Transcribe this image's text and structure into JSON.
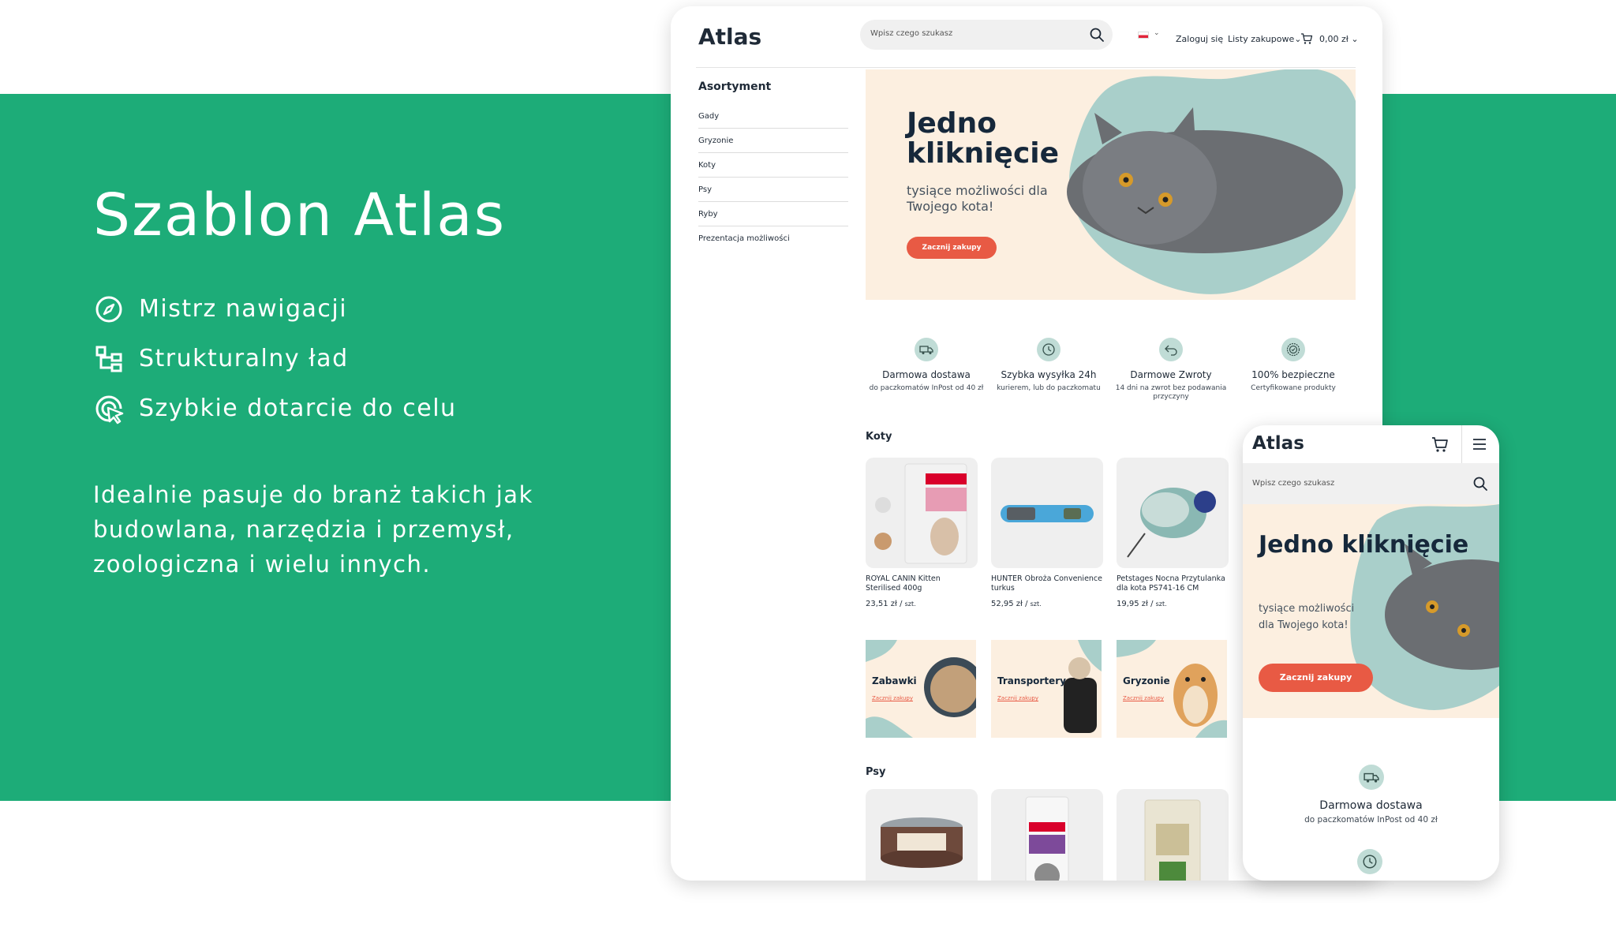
{
  "promo": {
    "title": "Szablon Atlas",
    "features": [
      {
        "label": "Mistrz nawigacji",
        "icon": "compass-icon"
      },
      {
        "label": "Strukturalny ład",
        "icon": "structure-icon"
      },
      {
        "label": "Szybkie dotarcie do celu",
        "icon": "target-cursor-icon"
      }
    ],
    "description": "Idealnie pasuje do branż takich jak budowlana, narzędzia i przemysł, zoologiczna i wielu innych."
  },
  "desktop": {
    "logo": "Atlas",
    "search_placeholder": "Wpisz czego szukasz",
    "login": "Zaloguj się",
    "shopping_lists": "Listy zakupowe",
    "cart_total": "0,00 zł",
    "sidebar": {
      "title": "Asortyment",
      "items": [
        "Gady",
        "Gryzonie",
        "Koty",
        "Psy",
        "Ryby",
        "Prezentacja możliwości"
      ]
    },
    "hero": {
      "title": "Jedno kliknięcie",
      "subtitle": "tysiące możliwości dla Twojego kota!",
      "button": "Zacznij zakupy"
    },
    "benefits": [
      {
        "title": "Darmowa dostawa",
        "desc": "do paczkomatów InPost od 40 zł",
        "icon": "delivery-truck-icon"
      },
      {
        "title": "Szybka wysyłka 24h",
        "desc": "kurierem, lub do paczkomatu",
        "icon": "clock-icon"
      },
      {
        "title": "Darmowe Zwroty",
        "desc": "14 dni na zwrot bez podawania przyczyny",
        "icon": "return-arrow-icon"
      },
      {
        "title": "100% bezpieczne",
        "desc": "Certyfikowane produkty",
        "icon": "certified-badge-icon"
      }
    ],
    "section_cats": "Koty",
    "products": [
      {
        "name": "ROYAL CANIN Kitten Sterilised 400g",
        "price": "23,51 zł",
        "unit": "szt."
      },
      {
        "name": "HUNTER Obroża Convenience turkus",
        "price": "52,95 zł",
        "unit": "szt."
      },
      {
        "name": "Petstages Nocna Przytulanka dla kota PS741-16 CM",
        "price": "19,95 zł",
        "unit": "szt."
      }
    ],
    "categories": [
      {
        "name": "Zabawki",
        "link": "Zacznij zakupy"
      },
      {
        "name": "Transportery",
        "link": "Zacznij zakupy"
      },
      {
        "name": "Gryzonie",
        "link": "Zacznij zakupy"
      }
    ],
    "section_dogs": "Psy"
  },
  "mobile": {
    "logo": "Atlas",
    "search_placeholder": "Wpisz czego szukasz",
    "hero": {
      "title": "Jedno kliknięcie",
      "subtitle": "tysiące możliwości dla Twojego kota!",
      "button": "Zacznij zakupy"
    },
    "benefit": {
      "title": "Darmowa dostawa",
      "desc": "do paczkomatów InPost od 40 zł"
    }
  },
  "colors": {
    "brand_green": "#1dac78",
    "accent_orange": "#e85a44",
    "hero_bg": "#fcefe0",
    "blob_teal": "#a9cfca"
  }
}
